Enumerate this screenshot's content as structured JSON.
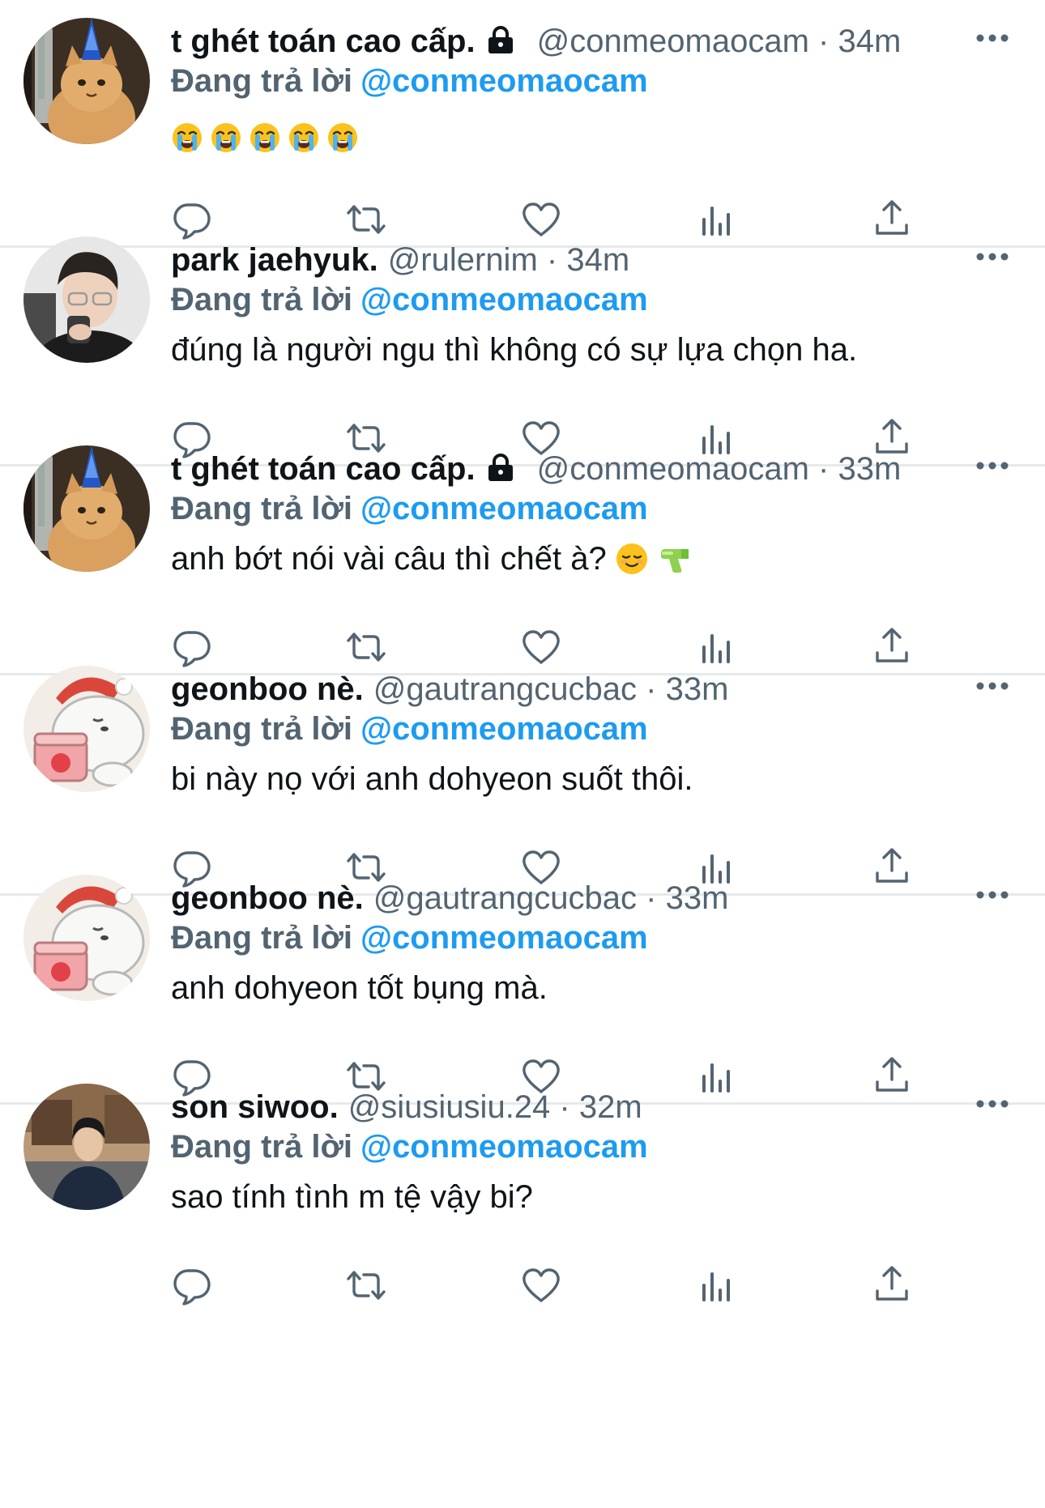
{
  "colors": {
    "text_primary": "#0f1419",
    "text_secondary": "#536471",
    "accent": "#1d9bf0",
    "divider": "#e7e9ea",
    "icon": "#536471"
  },
  "action_icons": [
    "reply-icon",
    "retweet-icon",
    "like-icon",
    "views-icon",
    "share-icon"
  ],
  "tweets": [
    {
      "avatar": "cat-party-hat-avatar",
      "display_name": "t ghét toán cao cấp.",
      "protected": true,
      "handle": "@conmeomaocam",
      "separator": "·",
      "time": "34m",
      "reply_prefix": "Đang trả lời",
      "reply_to": "@conmeomaocam",
      "text": "",
      "emojis": [
        "loudly-crying-face",
        "loudly-crying-face",
        "loudly-crying-face",
        "loudly-crying-face",
        "loudly-crying-face"
      ]
    },
    {
      "avatar": "person-glasses-avatar",
      "display_name": "park jaehyuk.",
      "protected": false,
      "handle": "@rulernim",
      "separator": "·",
      "time": "34m",
      "reply_prefix": "Đang trả lời",
      "reply_to": "@conmeomaocam",
      "text": "đúng là người ngu thì không có sự lựa chọn ha.",
      "emojis": []
    },
    {
      "avatar": "cat-party-hat-avatar",
      "display_name": "t ghét toán cao cấp.",
      "protected": true,
      "handle": "@conmeomaocam",
      "separator": "·",
      "time": "33m",
      "reply_prefix": "Đang trả lời",
      "reply_to": "@conmeomaocam",
      "text": "anh bớt nói vài câu thì chết à?",
      "emojis": [
        "smiling-face",
        "water-pistol"
      ]
    },
    {
      "avatar": "polar-bear-ice-cream-avatar",
      "display_name": "geonboo nè.",
      "protected": false,
      "handle": "@gautrangcucbac",
      "separator": "·",
      "time": "33m",
      "reply_prefix": "Đang trả lời",
      "reply_to": "@conmeomaocam",
      "text": "bi này nọ với anh dohyeon suốt thôi.",
      "emojis": []
    },
    {
      "avatar": "polar-bear-ice-cream-avatar",
      "display_name": "geonboo nè.",
      "protected": false,
      "handle": "@gautrangcucbac",
      "separator": "·",
      "time": "33m",
      "reply_prefix": "Đang trả lời",
      "reply_to": "@conmeomaocam",
      "text": "anh dohyeon tốt bụng mà.",
      "emojis": []
    },
    {
      "avatar": "person-street-avatar",
      "display_name": "son siwoo.",
      "protected": false,
      "handle": "@siusiusiu.24",
      "separator": "·",
      "time": "32m",
      "reply_prefix": "Đang trả lời",
      "reply_to": "@conmeomaocam",
      "text": "sao tính tình m tệ vậy bi?",
      "emojis": []
    }
  ]
}
